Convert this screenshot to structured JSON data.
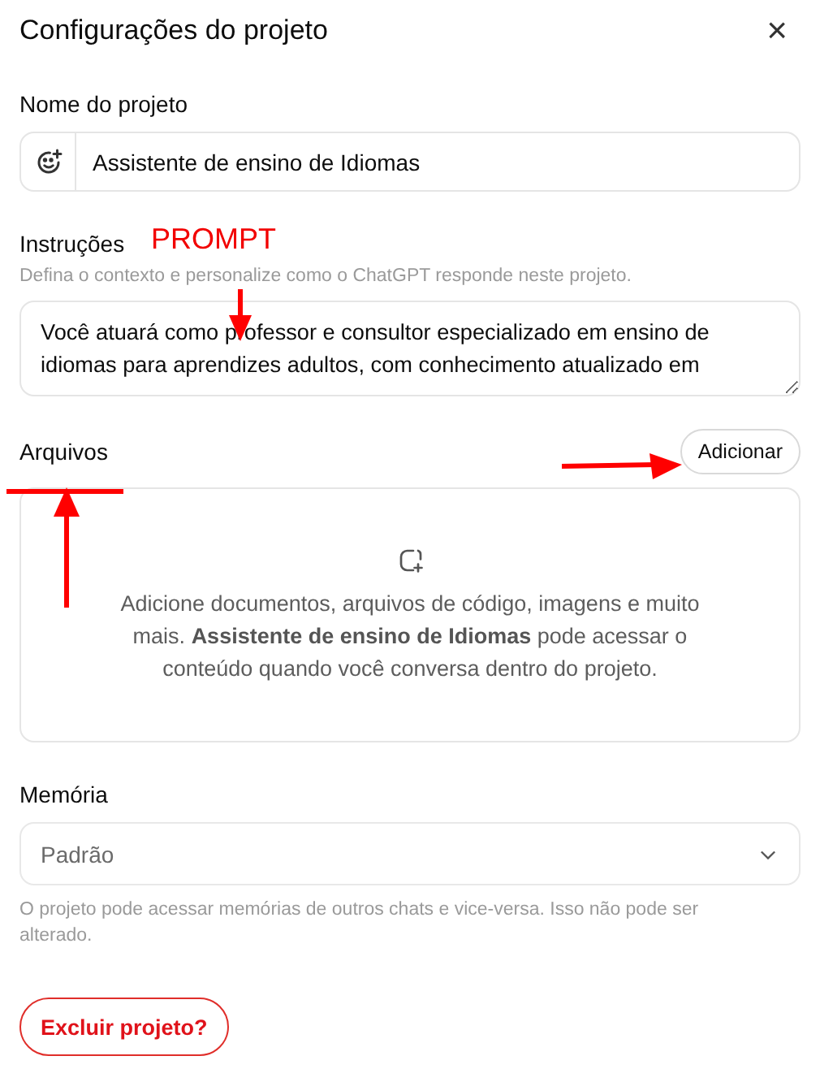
{
  "dialog": {
    "title": "Configurações do projeto",
    "close": "×"
  },
  "name_field": {
    "label": "Nome do projeto",
    "value": "Assistente de ensino de Idiomas"
  },
  "instructions": {
    "label": "Instruções",
    "hint": "Defina o contexto e personalize como o ChatGPT responde neste projeto.",
    "value": "Você atuará como professor e consultor especializado em ensino de idiomas para aprendizes adultos, com conhecimento atualizado em",
    "annotation": "PROMPT"
  },
  "files": {
    "label": "Arquivos",
    "add_button": "Adicionar",
    "empty_text": "Adicione documentos, arquivos de código, imagens e muito mais. **Assistente de ensino de Idiomas** pode acessar o conteúdo quando você conversa dentro do projeto."
  },
  "memory": {
    "label": "Memória",
    "value": "Padrão",
    "hint": "O projeto pode acessar memórias de outros chats e vice-versa. Isso não pode ser alterado."
  },
  "delete_button": "Excluir projeto?"
}
